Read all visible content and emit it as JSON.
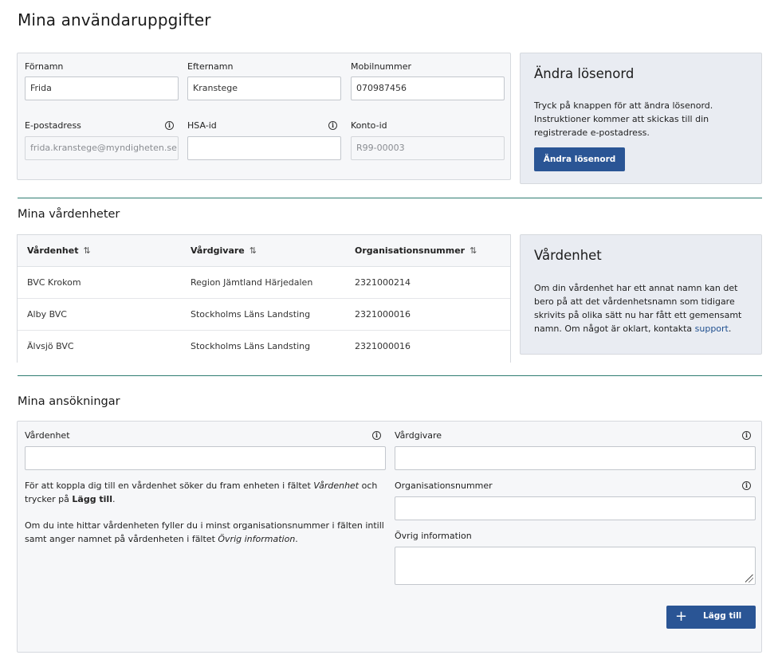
{
  "page": {
    "title": "Mina användaruppgifter"
  },
  "profile": {
    "first_name": {
      "label": "Förnamn",
      "value": "Frida"
    },
    "last_name": {
      "label": "Efternamn",
      "value": "Kranstege"
    },
    "mobile": {
      "label": "Mobilnummer",
      "value": "070987456"
    },
    "email": {
      "label": "E-postadress",
      "value": "frida.kranstege@myndigheten.se",
      "icon": "info-icon"
    },
    "hsa_id": {
      "label": "HSA-id",
      "value": "",
      "icon": "info-icon"
    },
    "account_id": {
      "label": "Konto-id",
      "value": "R99-00003"
    }
  },
  "change_password": {
    "title": "Ändra lösenord",
    "text": "Tryck på knappen för att ändra lösenord. Instruktioner kommer att skickas till din registrerade e-postadress.",
    "button_label": "Ändra lösenord"
  },
  "units": {
    "title": "Mina vårdenheter",
    "columns": [
      "Vårdenhet",
      "Vårdgivare",
      "Organisationsnummer"
    ],
    "sort_icon": "⇅",
    "rows": [
      [
        "BVC Krokom",
        "Region Jämtland Härjedalen",
        "2321000214"
      ],
      [
        "Alby BVC",
        "Stockholms Läns Landsting",
        "2321000016"
      ],
      [
        "Älvsjö BVC",
        "Stockholms Läns Landsting",
        "2321000016"
      ]
    ]
  },
  "unit_info": {
    "title": "Vårdenhet",
    "text": "Om din vårdenhet har ett annat namn kan det bero på att det vårdenhetsnamn som tidigare skrivits på olika sätt nu har fått ett gemensamt namn. Om något är oklart, kontakta ",
    "link": "support",
    "end": "."
  },
  "applications": {
    "title": "Mina ansökningar",
    "unit_label": "Vårdenhet",
    "provider_label": "Vårdgivare",
    "org_label": "Organisationsnummer",
    "other_label": "Övrig information",
    "help1_a": "För att koppla dig till en vårdenhet söker du fram enheten i fältet ",
    "help1_em": "Vårdenhet",
    "help1_b": " och trycker på ",
    "help1_strong": "Lägg till",
    "help1_c": ".",
    "help2_a": "Om du inte hittar vårdenheten fyller du i minst organisationsnummer i fälten intill samt anger namnet på vårdenheten i fältet ",
    "help2_em": "Övrig information",
    "help2_b": ".",
    "add_button_label": "Lägg till",
    "add_icon": "+"
  },
  "colors": {
    "primary": "#2a5595",
    "divider": "#2f7d72",
    "panel": "#f6f7f9",
    "aside": "#e9ecf2"
  }
}
